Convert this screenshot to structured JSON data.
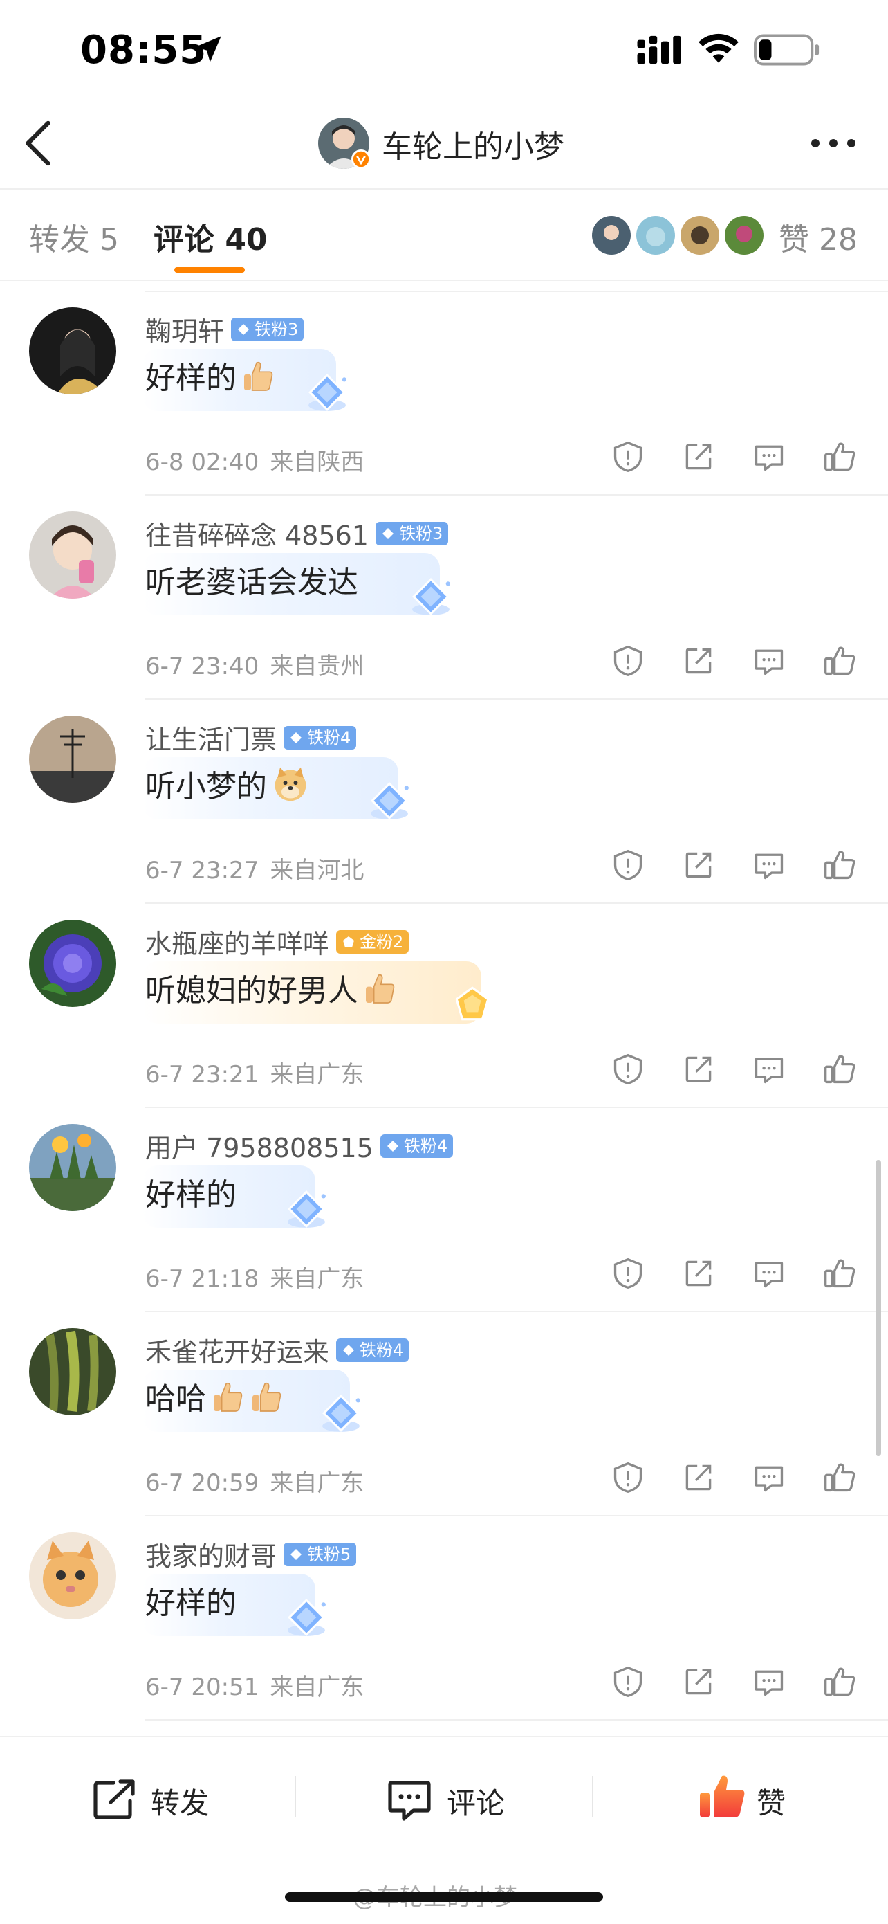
{
  "status": {
    "time": "08:55"
  },
  "nav": {
    "title": "车轮上的小梦"
  },
  "tabs": {
    "repost_label": "转发 5",
    "comment_label": "评论 40",
    "like_label": "赞 28"
  },
  "comments": [
    {
      "username": "鞠玥轩",
      "badge": "铁粉3",
      "badge_type": "iron",
      "text": "好样的",
      "thumbs": 1,
      "time": "6-8 02:40",
      "location": "来自陕西"
    },
    {
      "username": "往昔碎碎念 48561",
      "badge": "铁粉3",
      "badge_type": "iron",
      "text": "听老婆话会发达",
      "thumbs": 0,
      "time": "6-7 23:40",
      "location": "来自贵州"
    },
    {
      "username": "让生活门票",
      "badge": "铁粉4",
      "badge_type": "iron",
      "text": "听小梦的",
      "thumbs": 0,
      "doge": true,
      "time": "6-7 23:27",
      "location": "来自河北"
    },
    {
      "username": "水瓶座的羊咩咩",
      "badge": "金粉2",
      "badge_type": "gold",
      "text": "听媳妇的好男人",
      "thumbs": 1,
      "time": "6-7 23:21",
      "location": "来自广东"
    },
    {
      "username": "用户 7958808515",
      "badge": "铁粉4",
      "badge_type": "iron",
      "text": "好样的",
      "thumbs": 0,
      "time": "6-7 21:18",
      "location": "来自广东"
    },
    {
      "username": "禾雀花开好运来",
      "badge": "铁粉4",
      "badge_type": "iron",
      "text": "哈哈",
      "thumbs": 2,
      "time": "6-7 20:59",
      "location": "来自广东"
    },
    {
      "username": "我家的财哥",
      "badge": "铁粉5",
      "badge_type": "iron",
      "text": "好样的",
      "thumbs": 0,
      "time": "6-7 20:51",
      "location": "来自广东"
    }
  ],
  "bottom_bar": {
    "repost": "转发",
    "comment": "评论",
    "like": "赞"
  },
  "watermark": "@车轮上的小梦",
  "colors": {
    "accent": "#ff8200",
    "iron_badge": "#6fa6ee",
    "gold_badge": "#f6b13a",
    "like_red": "#f5484a"
  }
}
